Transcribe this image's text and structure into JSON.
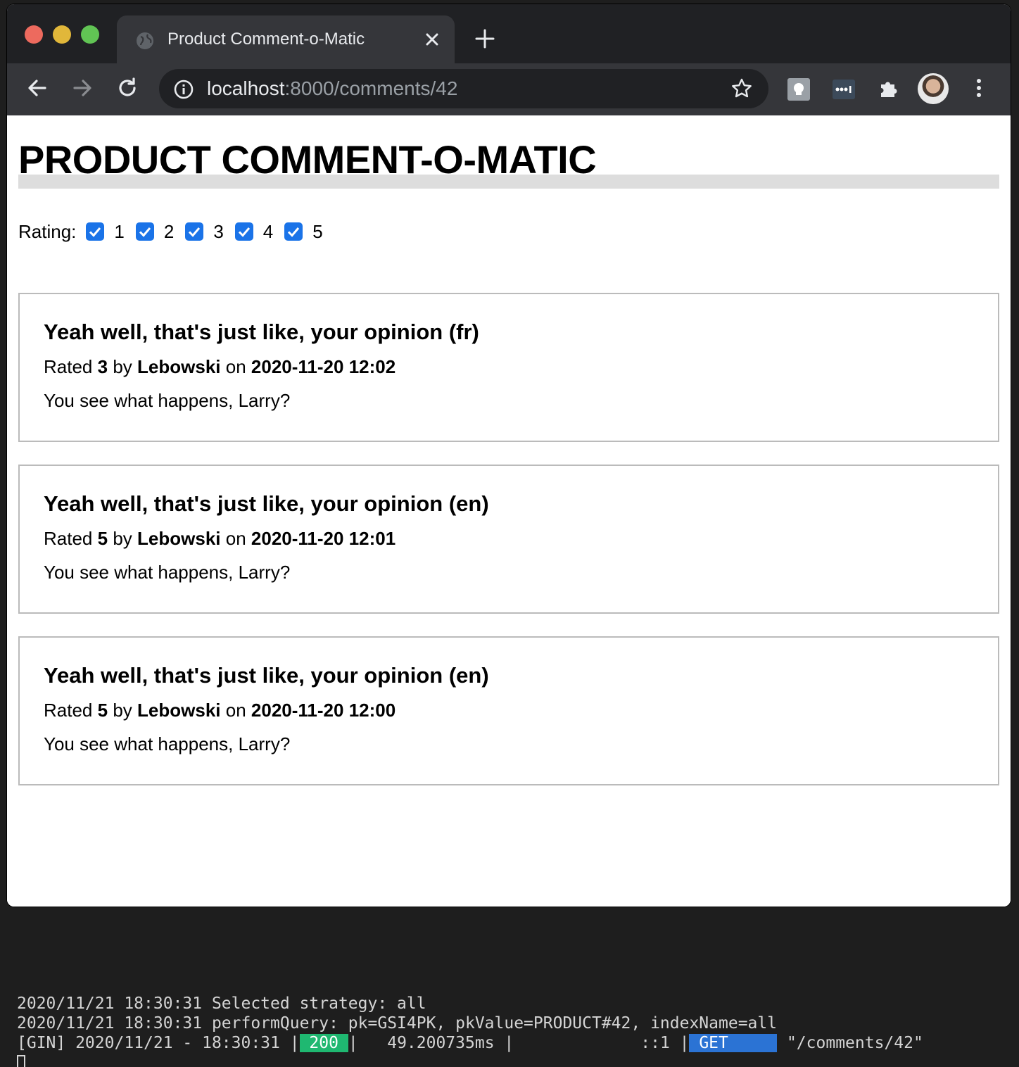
{
  "browser": {
    "tab_title": "Product Comment-o-Matic",
    "url_host": "localhost",
    "url_rest": ":8000/comments/42"
  },
  "page": {
    "title": "PRODUCT COMMENT-O-MATIC",
    "filter": {
      "label": "Rating:",
      "options": [
        {
          "value": "1",
          "checked": true
        },
        {
          "value": "2",
          "checked": true
        },
        {
          "value": "3",
          "checked": true
        },
        {
          "value": "4",
          "checked": true
        },
        {
          "value": "5",
          "checked": true
        }
      ]
    },
    "comments": [
      {
        "title": "Yeah well, that's just like, your opinion (fr)",
        "rated_prefix": "Rated",
        "rating": "3",
        "by_word": "by",
        "author": "Lebowski",
        "on_word": "on",
        "timestamp": "2020-11-20 12:02",
        "body": "You see what happens, Larry?"
      },
      {
        "title": "Yeah well, that's just like, your opinion (en)",
        "rated_prefix": "Rated",
        "rating": "5",
        "by_word": "by",
        "author": "Lebowski",
        "on_word": "on",
        "timestamp": "2020-11-20 12:01",
        "body": "You see what happens, Larry?"
      },
      {
        "title": "Yeah well, that's just like, your opinion (en)",
        "rated_prefix": "Rated",
        "rating": "5",
        "by_word": "by",
        "author": "Lebowski",
        "on_word": "on",
        "timestamp": "2020-11-20 12:00",
        "body": "You see what happens, Larry?"
      }
    ]
  },
  "terminal": {
    "line1": "2020/11/21 18:30:31 Selected strategy: all",
    "line2": "2020/11/21 18:30:31 performQuery: pk=GSI4PK, pkValue=PRODUCT#42, indexName=all",
    "line3_prefix": "[GIN] 2020/11/21 - 18:30:31 |",
    "status": " 200 ",
    "line3_mid": "|   49.200735ms |             ::1 |",
    "method": " GET     ",
    "path": " \"/comments/42\""
  },
  "colors": {
    "checkbox": "#1a73e8",
    "status_badge": "#1fb871",
    "method_badge": "#2b73d4"
  }
}
